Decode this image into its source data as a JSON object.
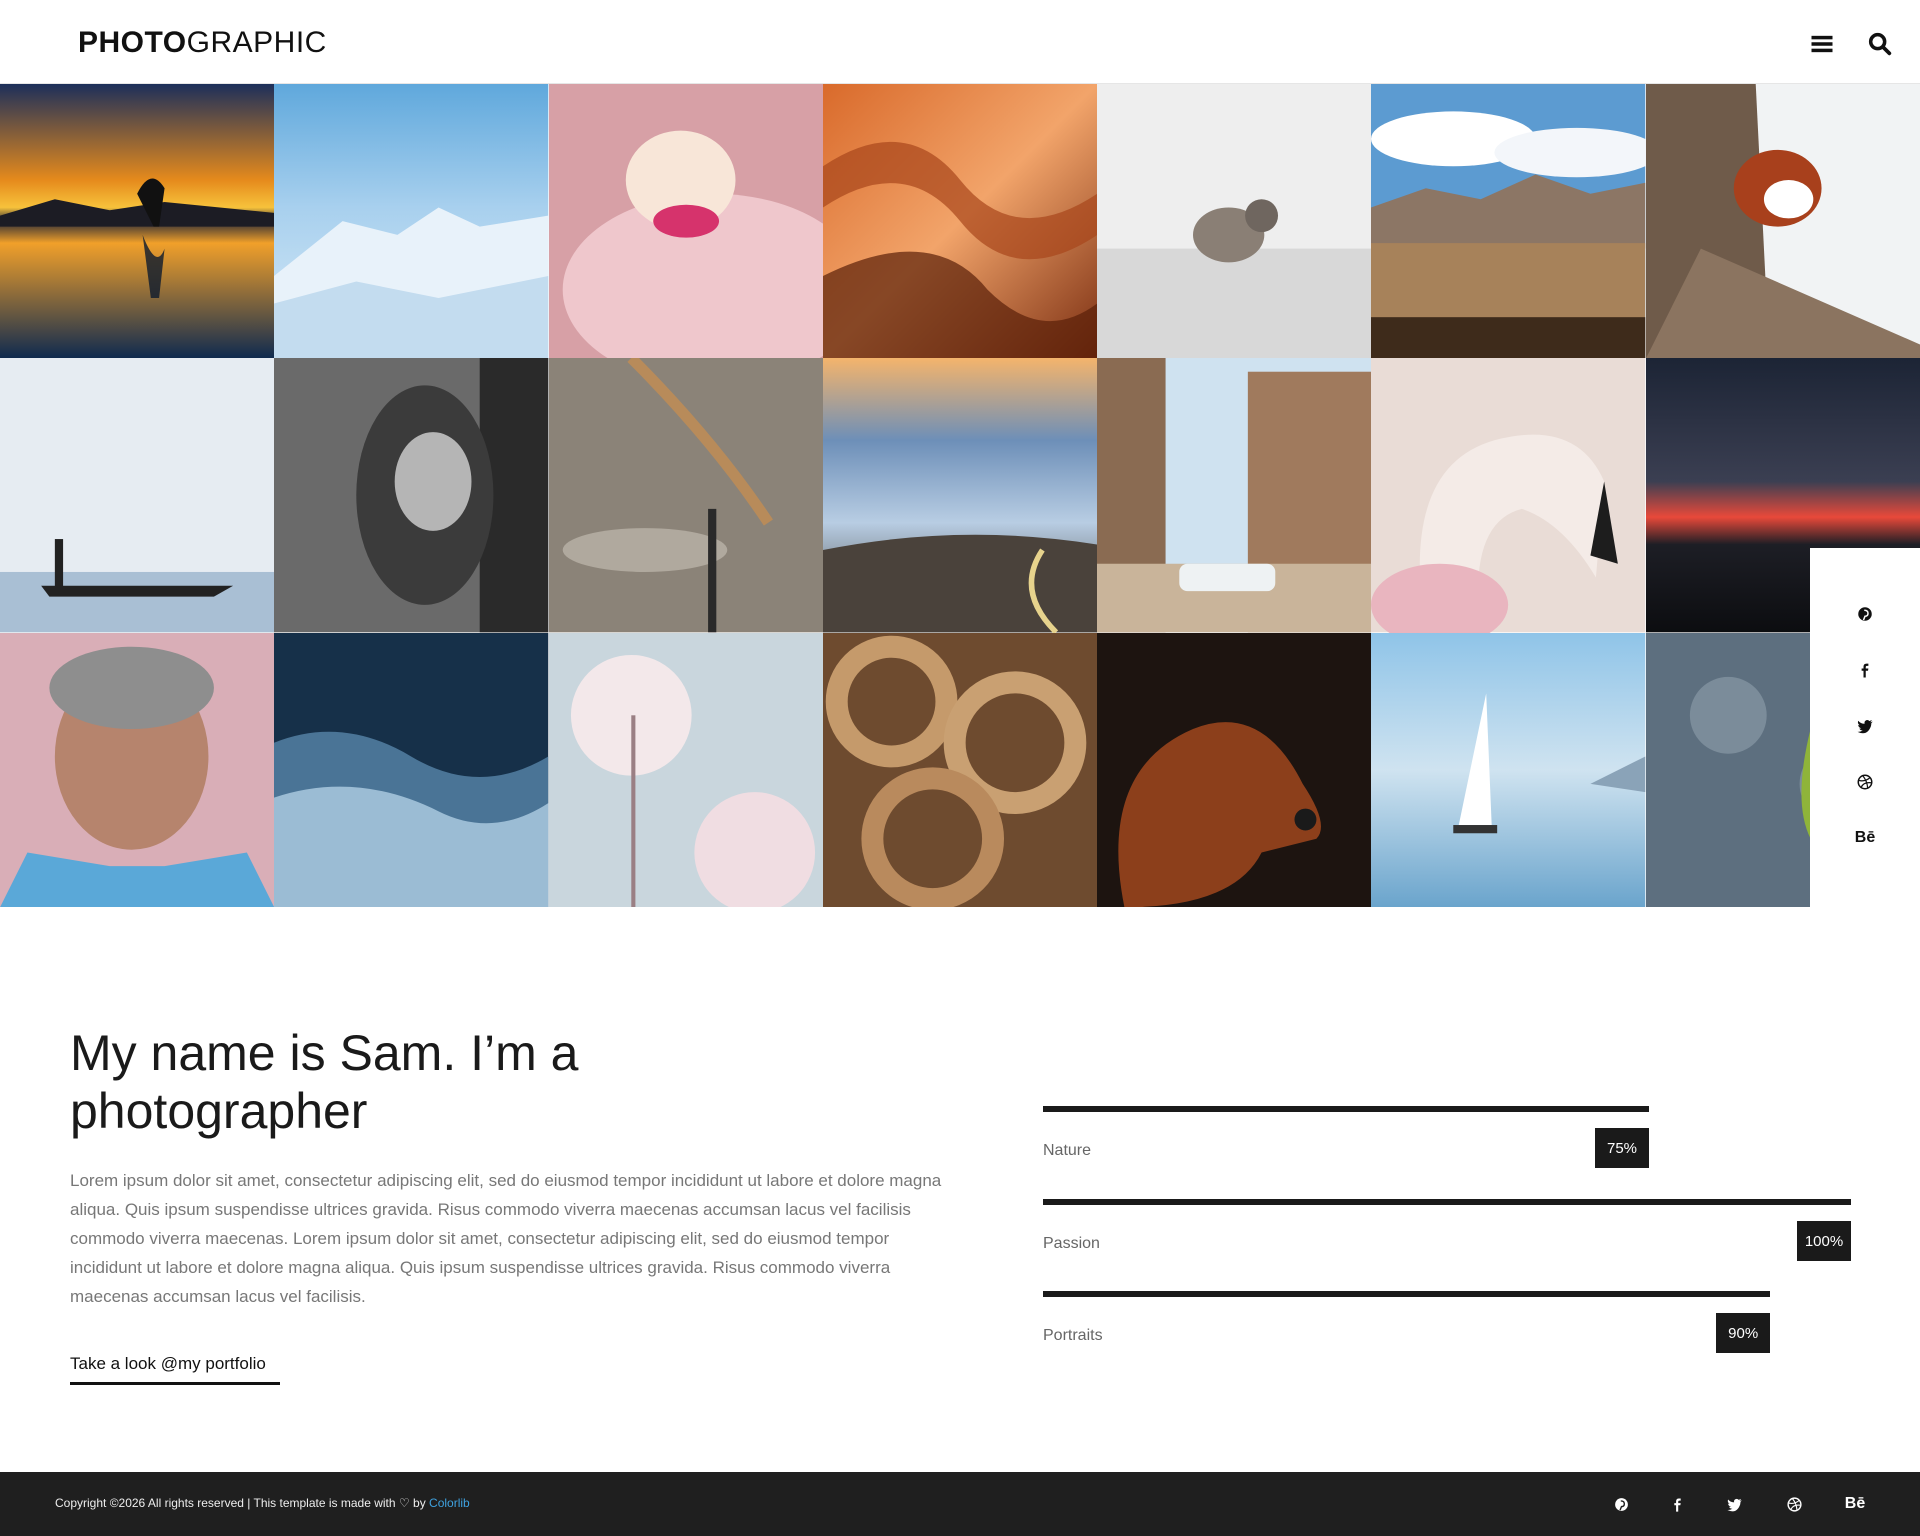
{
  "header": {
    "logo_bold": "PHOTO",
    "logo_light": "GRAPHIC",
    "menu_icon": "hamburger-menu-icon",
    "search_icon": "search-icon"
  },
  "gallery": {
    "tiles": [
      "sunset-lake-yoga",
      "snowy-mountains",
      "pink-flower-bud",
      "canyon-sandstone",
      "small-bird-snow",
      "desert-mountains",
      "red-panda-tree",
      "fisherman-boat-mist",
      "girl-black-white",
      "dragonfly-grass",
      "clouds-road",
      "old-building-car",
      "flamingo",
      "night-sky-sunset",
      "elderly-woman-portrait",
      "ocean-waves",
      "dandelion-seeds",
      "coiled-rope",
      "brown-dog",
      "sailboat-lake",
      "ginkgo-leaf-stone"
    ]
  },
  "social_side": [
    "pinterest-icon",
    "facebook-icon",
    "twitter-icon",
    "dribbble-icon",
    "behance-icon"
  ],
  "social_side_behance_text": "Bē",
  "about": {
    "title": "My name is Sam. I’m a photographer",
    "text": "Lorem ipsum dolor sit amet, consectetur adipiscing elit, sed do eiusmod tempor incididunt ut labore et dolore magna aliqua. Quis ipsum suspendisse ultrices gravida. Risus commodo viverra maecenas accumsan lacus vel facilisis commodo viverra maecenas. Lorem ipsum dolor sit amet, consectetur adipiscing elit, sed do eiusmod tempor incididunt ut labore et dolore magna aliqua. Quis ipsum suspendisse ultrices gravida. Risus commodo viverra maecenas accumsan lacus vel facilisis.",
    "link": "Take a look @my portfolio"
  },
  "skills": [
    {
      "label": "Nature",
      "percent": 75,
      "percent_text": "75%"
    },
    {
      "label": "Passion",
      "percent": 100,
      "percent_text": "100%"
    },
    {
      "label": "Portraits",
      "percent": 90,
      "percent_text": "90%"
    }
  ],
  "footer": {
    "copyright_prefix": "Copyright ©2026 All rights reserved | This template is made with",
    "heart": "♡",
    "by": "by",
    "brand": "Colorlib",
    "behance_text": "Bē"
  },
  "colors": {
    "dark": "#1a1a1a",
    "footer_bg": "#1f1f1f",
    "link_blue": "#3fa2e0",
    "muted_text": "#777777"
  }
}
